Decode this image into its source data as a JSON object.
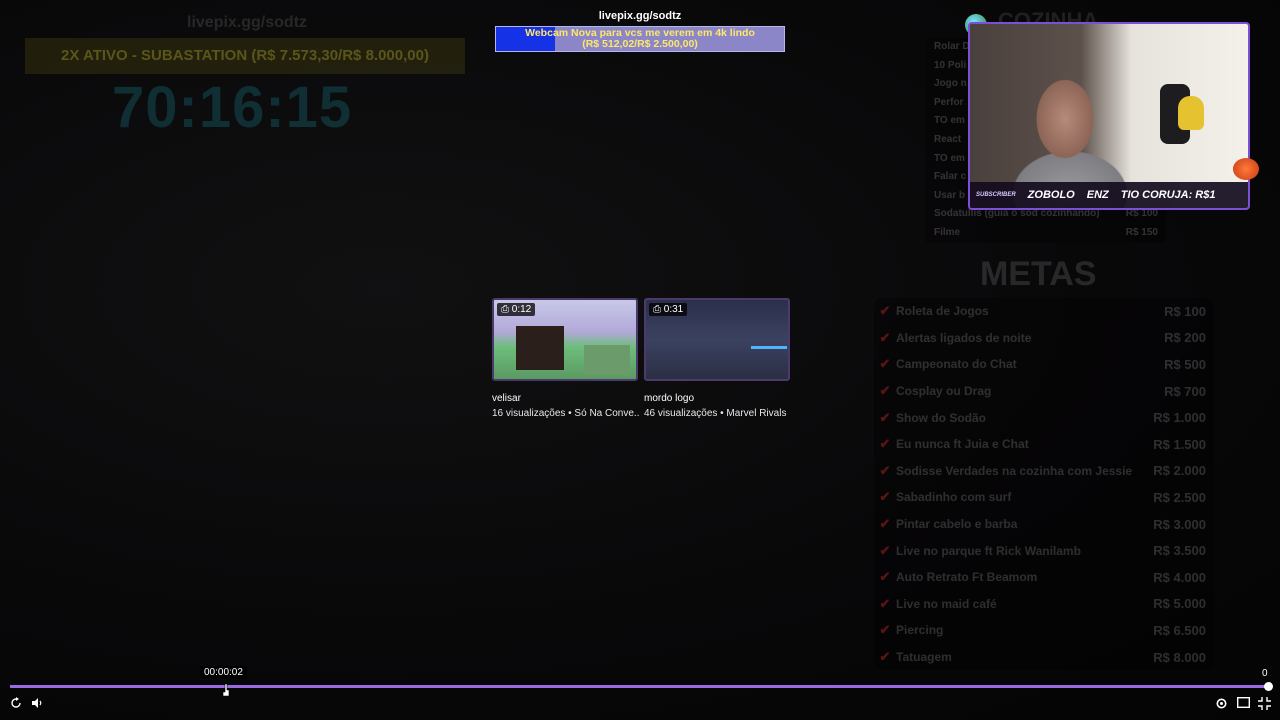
{
  "stream_overlay": {
    "url_left": "livepix.gg/sodtz",
    "goal_banner": "2X ATIVO - SUBASTATION (R$ 7.573,30/R$ 8.000,00)",
    "timer": "70:16:15",
    "top_url": "livepix.gg/sodtz",
    "webcam_goal_text": "Webcam Nova para vcs me verem em 4k lindo",
    "webcam_goal_amount": "(R$ 512,02/R$ 2.500,00)",
    "webcam_goal_progress": 0.2048
  },
  "cozinha": {
    "title": "COZINHA",
    "items": [
      {
        "name": "Rolar D",
        "price": ""
      },
      {
        "name": "10 Poli",
        "price": ""
      },
      {
        "name": "Jogo n",
        "price": ""
      },
      {
        "name": "Perfor",
        "price": ""
      },
      {
        "name": "TO em",
        "price": ""
      },
      {
        "name": "React",
        "price": ""
      },
      {
        "name": "TO em",
        "price": ""
      },
      {
        "name": "Falar c",
        "price": ""
      },
      {
        "name": "Usar b",
        "price": ""
      },
      {
        "name": "Sodatullis (guia o sod cozinhando)",
        "price": "R$ 100"
      },
      {
        "name": "Filme",
        "price": "R$ 150"
      }
    ]
  },
  "metas": {
    "title": "METAS",
    "items": [
      {
        "name": "Roleta de Jogos",
        "value": "R$ 100"
      },
      {
        "name": "Alertas ligados de noite",
        "value": "R$ 200"
      },
      {
        "name": "Campeonato do Chat",
        "value": "R$ 500"
      },
      {
        "name": "Cosplay ou Drag",
        "value": "R$ 700"
      },
      {
        "name": "Show do Sodão",
        "value": "R$ 1.000"
      },
      {
        "name": "Eu nunca ft Juia e Chat",
        "value": "R$ 1.500"
      },
      {
        "name": "Sodisse Verdades na cozinha com Jessie",
        "value": "R$ 2.000"
      },
      {
        "name": "Sabadinho com surf",
        "value": "R$ 2.500"
      },
      {
        "name": "Pintar cabelo e barba",
        "value": "R$ 3.000"
      },
      {
        "name": "Live no parque ft Rick Wanilamb",
        "value": "R$ 3.500"
      },
      {
        "name": "Auto Retrato Ft Beamom",
        "value": "R$ 4.000"
      },
      {
        "name": "Live no maid café",
        "value": "R$ 5.000"
      },
      {
        "name": "Piercing",
        "value": "R$ 6.500"
      },
      {
        "name": "Tatuagem",
        "value": "R$ 8.000"
      }
    ]
  },
  "webcam": {
    "subscriber_label": "SUBSCRIBER",
    "names": [
      "ZOBOLO",
      "ENZ",
      "TIO CORUJA: R$1"
    ]
  },
  "related_videos": [
    {
      "duration": "0:12",
      "title": "velisar",
      "meta": "16 visualizações • Só Na Conve..."
    },
    {
      "duration": "0:31",
      "title": "mordo logo",
      "meta": "46 visualizações • Marvel Rivals"
    }
  ],
  "player": {
    "hover_time": "00:00:02",
    "right_count": "0",
    "progress": 1.0,
    "accent_color": "#9b6ae0"
  },
  "icons": [
    "replay-icon",
    "volume-icon",
    "settings-icon",
    "theater-icon",
    "exit-fullscreen-icon",
    "clip-icon"
  ]
}
